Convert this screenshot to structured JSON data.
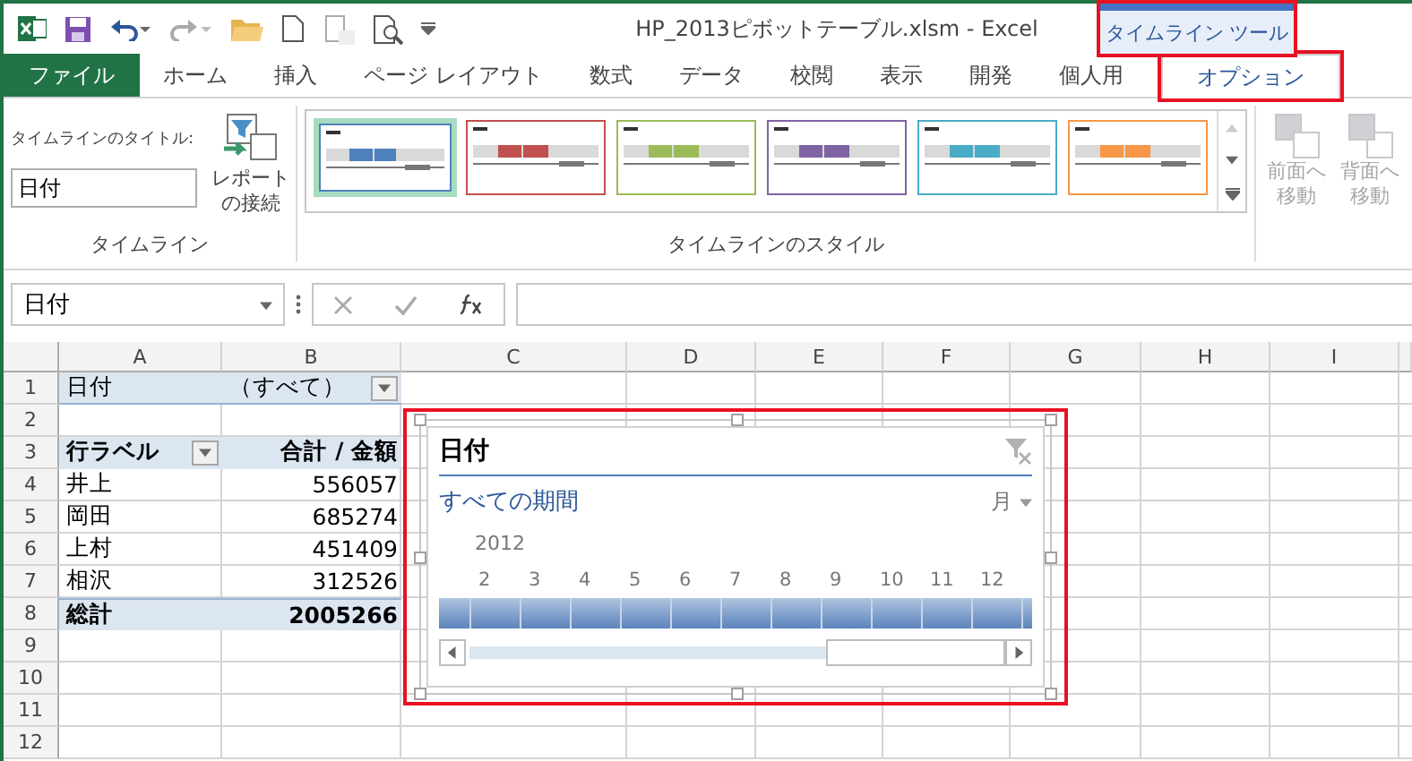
{
  "window": {
    "title": "HP_2013ピボットテーブル.xlsm - Excel"
  },
  "contextual_group": {
    "label": "タイムライン ツール"
  },
  "tabs": [
    {
      "label": "ファイル",
      "kind": "file",
      "selected": false
    },
    {
      "label": "ホーム",
      "kind": "tab",
      "selected": false
    },
    {
      "label": "挿入",
      "kind": "tab",
      "selected": false
    },
    {
      "label": "ページ レイアウト",
      "kind": "tab",
      "selected": false
    },
    {
      "label": "数式",
      "kind": "tab",
      "selected": false
    },
    {
      "label": "データ",
      "kind": "tab",
      "selected": false
    },
    {
      "label": "校閲",
      "kind": "tab",
      "selected": false
    },
    {
      "label": "表示",
      "kind": "tab",
      "selected": false
    },
    {
      "label": "開発",
      "kind": "tab",
      "selected": false
    },
    {
      "label": "個人用",
      "kind": "tab",
      "selected": false
    },
    {
      "label": "オプション",
      "kind": "contextual",
      "selected": true
    }
  ],
  "ribbon": {
    "timeline_group": {
      "label": "タイムライン",
      "title_label": "タイムラインのタイトル:",
      "title_value": "日付",
      "connect_button": [
        "レポート",
        "の接続"
      ]
    },
    "styles_group": {
      "label": "タイムラインのスタイル",
      "styles": [
        {
          "color": "#4f81bd",
          "selected": true
        },
        {
          "color": "#c0504d",
          "selected": false
        },
        {
          "color": "#9bbb59",
          "selected": false
        },
        {
          "color": "#8064a2",
          "selected": false
        },
        {
          "color": "#4bacc6",
          "selected": false
        },
        {
          "color": "#f79646",
          "selected": false
        }
      ]
    },
    "arrange_buttons": [
      {
        "lines": [
          "前面へ",
          "移動"
        ],
        "disabled": true
      },
      {
        "lines": [
          "背面へ",
          "移動"
        ],
        "disabled": true
      }
    ]
  },
  "formula_bar": {
    "name_box": "日付"
  },
  "columns": [
    "A",
    "B",
    "C",
    "D",
    "E",
    "F",
    "G",
    "H",
    "I"
  ],
  "rows": [
    "1",
    "2",
    "3",
    "4",
    "5",
    "6",
    "7",
    "8",
    "9",
    "10",
    "11",
    "12"
  ],
  "pivot": {
    "filter": {
      "field": "日付",
      "value": "（すべて）"
    },
    "header": {
      "row_label": "行ラベル",
      "value_label": "合計 / 金額"
    },
    "rows": [
      {
        "label": "井上",
        "value": "556057"
      },
      {
        "label": "岡田",
        "value": "685274"
      },
      {
        "label": "上村",
        "value": "451409"
      },
      {
        "label": "相沢",
        "value": "312526"
      }
    ],
    "total": {
      "label": "総計",
      "value": "2005266"
    }
  },
  "timeline": {
    "title": "日付",
    "period": "すべての期間",
    "level": "月",
    "year": "2012",
    "months": [
      "2",
      "3",
      "4",
      "5",
      "6",
      "7",
      "8",
      "9",
      "10",
      "11",
      "12"
    ]
  }
}
